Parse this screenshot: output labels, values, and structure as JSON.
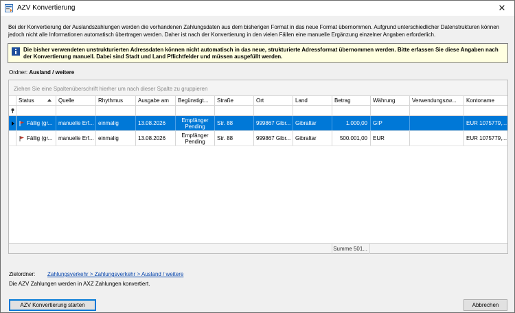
{
  "window": {
    "title": "AZV Konvertierung",
    "close_glyph": "✕"
  },
  "intro_text": "Bei der Konvertierung der Auslandszahlungen werden die vorhandenen Zahlungsdaten aus dem bisherigen Format in das neue Format übernommen. Aufgrund unterschiedlicher Datenstrukturen können jedoch nicht alle Informationen automatisch übertragen werden. Daher ist nach der Konvertierung in den vielen Fällen eine manuelle Ergänzung einzelner Angaben erforderlich.",
  "info": {
    "icon": "info-icon",
    "text": "Die bisher verwendeten unstrukturierten Adressdaten können nicht automatisch in das neue, strukturierte Adressformat übernommen werden. Bitte erfassen Sie diese Angaben nach der Konvertierung manuell. Dabei sind Stadt und Land Pflichtfelder und müssen ausgefüllt werden."
  },
  "folder": {
    "label": "Ordner:",
    "value": "Ausland / weitere"
  },
  "grid": {
    "group_hint": "Ziehen Sie eine Spaltenüberschrift hierher um nach dieser Spalte zu gruppieren",
    "columns": [
      "Status",
      "Quelle",
      "Rhythmus",
      "Ausgabe am",
      "Begünstigt...",
      "Straße",
      "Ort",
      "Land",
      "Betrag",
      "Währung",
      "Verwendungszw...",
      "Kontoname"
    ],
    "rows": [
      {
        "status": "Fällig (gr...",
        "quelle": "manuelle Erf...",
        "rhythmus": "einmalig",
        "ausgabe": "13.08.2026",
        "beguenstigter": "Empfänger Pending",
        "strasse": "Str. 88",
        "ort": "999867 Gibr...",
        "land": "Gibraltar",
        "betrag": "1.000,00",
        "waehrung": "GIP",
        "verwendung": "",
        "kontoname": "EUR 1075779,..."
      },
      {
        "status": "Fällig (gr...",
        "quelle": "manuelle Erf...",
        "rhythmus": "einmalig",
        "ausgabe": "13.08.2026",
        "beguenstigter": "Empfänger Pending",
        "strasse": "Str. 88",
        "ort": "999867 Gibr...",
        "land": "Gibraltar",
        "betrag": "500.001,00",
        "waehrung": "EUR",
        "verwendung": "",
        "kontoname": "EUR 1075779,..."
      }
    ],
    "sum_label": "Summe 501..."
  },
  "target": {
    "label": "Zielordner:",
    "link": "Zahlungsverkehr > Zahlungsverkehr > Ausland / weitere"
  },
  "note": "Die AZV Zahlungen werden in AXZ Zahlungen konvertiert.",
  "buttons": {
    "start": "AZV Konvertierung starten",
    "cancel": "Abbrechen"
  },
  "colors": {
    "selection": "#0078d7",
    "info_background": "#ffffe1",
    "status_flag": "#c0392b"
  }
}
